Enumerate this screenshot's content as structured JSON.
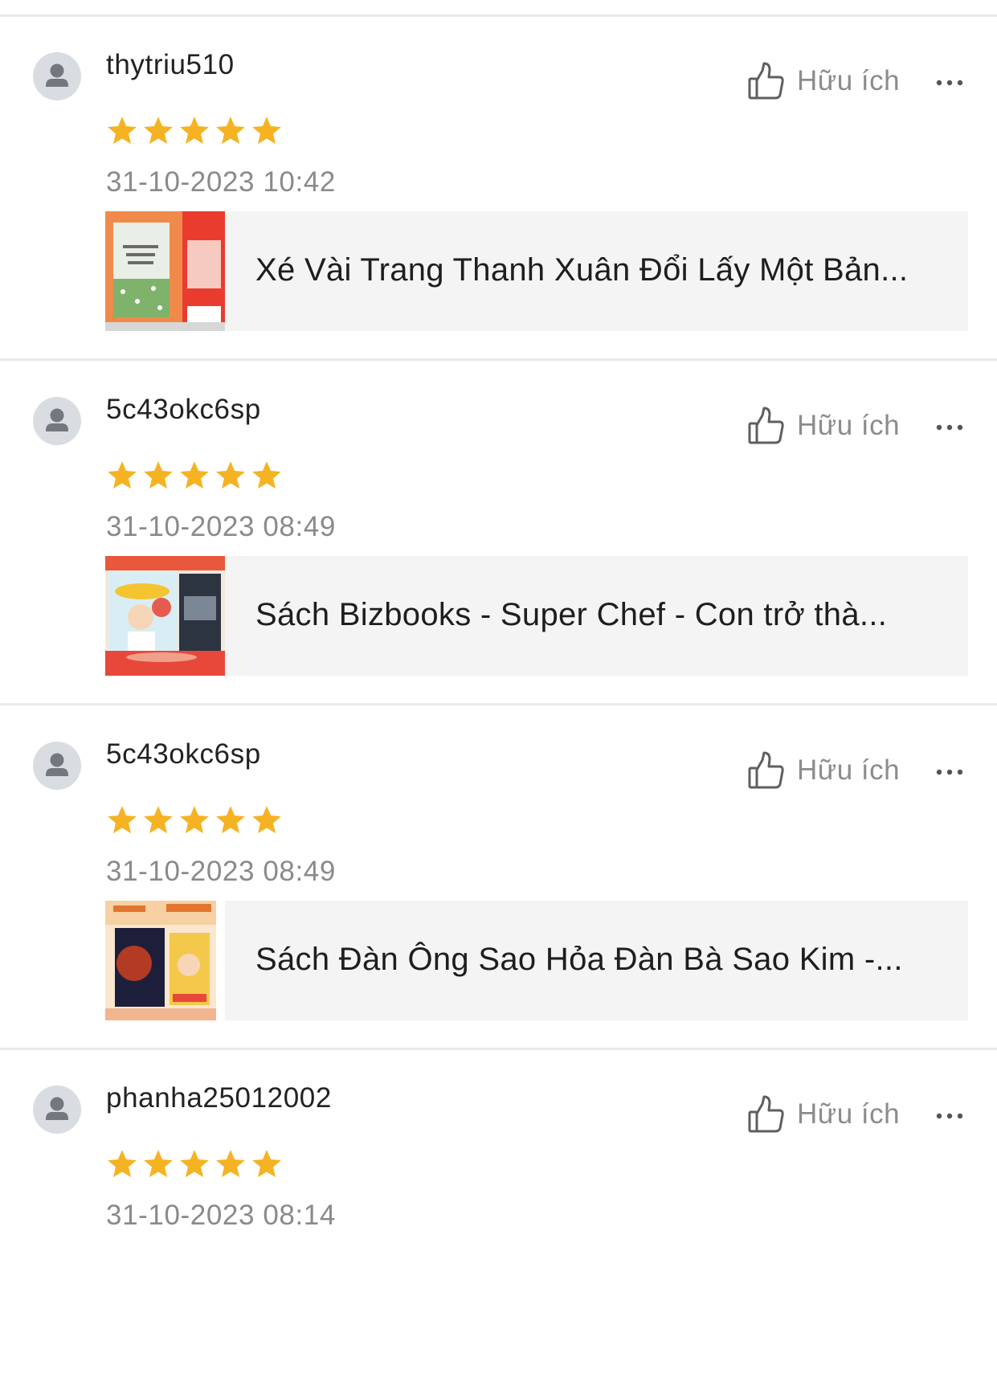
{
  "colors": {
    "star": "#f5b324",
    "divider": "#e9e9e9",
    "card_background": "#f4f4f4",
    "avatar_background": "#d9dde1",
    "muted_text": "#8a8a8a"
  },
  "icons": {
    "avatar": "person-icon",
    "helpful": "thumbs-up-icon",
    "more": "more-dots-icon",
    "star": "star-icon"
  },
  "reviews": [
    {
      "username": "thytriu510",
      "rating": 5,
      "timestamp": "31-10-2023 10:42",
      "helpful_label": "Hữu ích",
      "product_title": "Xé Vài Trang Thanh Xuân Đổi Lấy Một Bản..."
    },
    {
      "username": "5c43okc6sp",
      "rating": 5,
      "timestamp": "31-10-2023 08:49",
      "helpful_label": "Hữu ích",
      "product_title": "Sách Bizbooks - Super Chef - Con trở thà..."
    },
    {
      "username": "5c43okc6sp",
      "rating": 5,
      "timestamp": "31-10-2023 08:49",
      "helpful_label": "Hữu ích",
      "product_title": "Sách Đàn Ông Sao Hỏa Đàn Bà Sao Kim -..."
    },
    {
      "username": "phanha25012002",
      "rating": 5,
      "timestamp": "31-10-2023 08:14",
      "helpful_label": "Hữu ích",
      "product_title": ""
    }
  ]
}
